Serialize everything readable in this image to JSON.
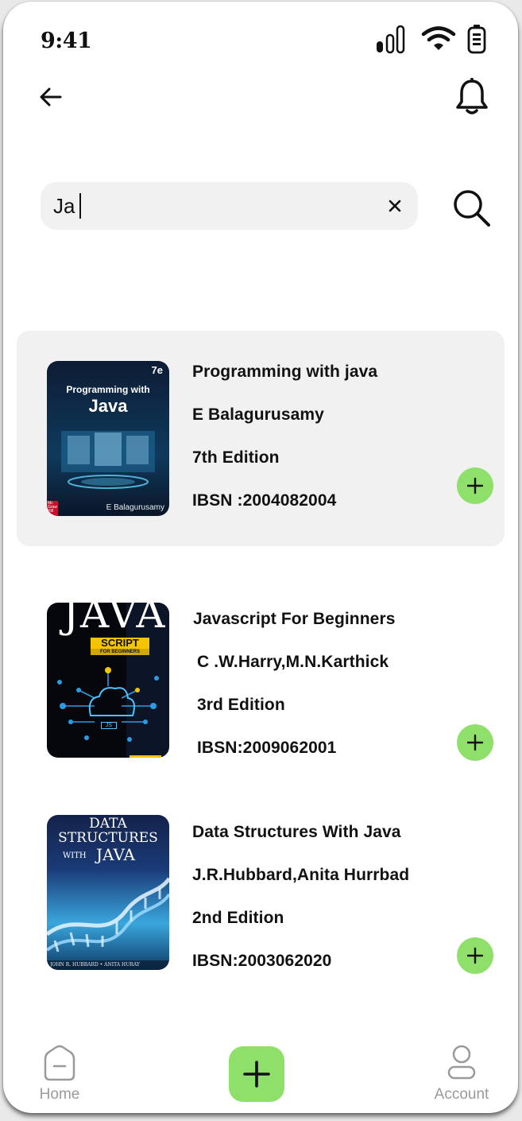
{
  "status_bar": {
    "time": "9:41"
  },
  "header": {
    "back_icon": "arrow-left-icon",
    "notification_icon": "bell-icon"
  },
  "search": {
    "value": "Ja",
    "clear_icon": "close-icon",
    "search_icon": "search-icon"
  },
  "books": [
    {
      "title": "Programming with java",
      "author": "E Balagurusamy",
      "edition": "7th Edition",
      "isbn": "IBSN :2004082004",
      "cover": {
        "line1": "Programming with",
        "line2": "Java",
        "badge": "7e",
        "author": "E Balagurusamy",
        "publisher": "Mc Graw Hill"
      }
    },
    {
      "title": "Javascript For Beginners",
      "author": "C .W.Harry,M.N.Karthick",
      "edition": "3rd Edition",
      "isbn": "IBSN:2009062001",
      "cover": {
        "line1": "JAVA",
        "line2": "SCRIPT",
        "line3": "FOR BEGINNERS",
        "chip": "JS"
      }
    },
    {
      "title": "Data Structures With Java",
      "author": "J.R.Hubbard,Anita Hurrbad",
      "edition": "2nd Edition",
      "isbn": "IBSN:2003062020",
      "cover": {
        "line1": "DATA",
        "line2": "STRUCTURES",
        "line3": "WITH",
        "line4": "JAVA",
        "authors": "JOHN R. HUBBARD • ANITA HURAY"
      }
    }
  ],
  "bottom_nav": {
    "home_label": "Home",
    "account_label": "Account",
    "accent": "#8fe06a"
  }
}
